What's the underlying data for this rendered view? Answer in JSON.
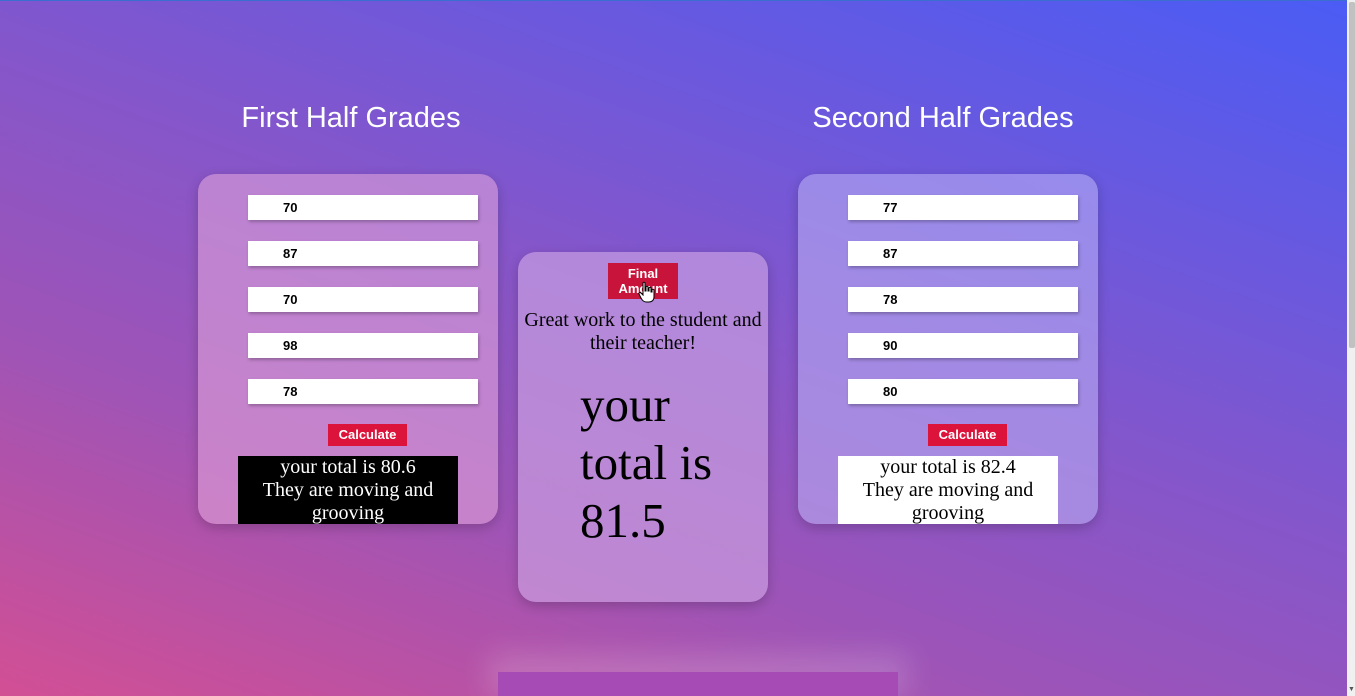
{
  "first_half": {
    "title": "First Half Grades",
    "grades": [
      "70",
      "87",
      "70",
      "98",
      "78"
    ],
    "calculate_label": "Calculate",
    "result_line1": "your total is 80.6",
    "result_line2": "They are moving and grooving"
  },
  "second_half": {
    "title": "Second Half Grades",
    "grades": [
      "77",
      "87",
      "78",
      "90",
      "80"
    ],
    "calculate_label": "Calculate",
    "result_line1": "your total is 82.4",
    "result_line2": "They are moving and grooving"
  },
  "final": {
    "button_label": "Final Amount",
    "praise": "Great work to the student and their teacher!",
    "total": "your total is 81.5"
  },
  "colors": {
    "button": "#dc143c",
    "final_button": "#c8143a"
  }
}
